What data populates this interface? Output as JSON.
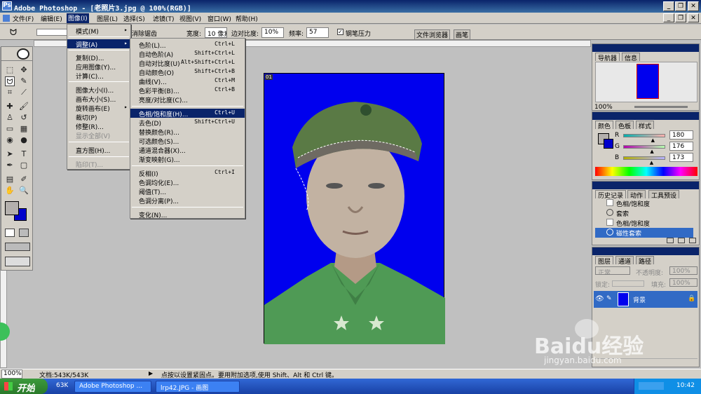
{
  "window": {
    "title": "Adobe Photoshop - [老照片3.jpg @ 100%(RGB)]"
  },
  "menubar": {
    "items": [
      "文件(F)",
      "编辑(E)",
      "图像(I)",
      "图层(L)",
      "选择(S)",
      "滤镜(T)",
      "视图(V)",
      "窗口(W)",
      "帮助(H)"
    ]
  },
  "options": {
    "anti_alias": "消除锯齿",
    "width_label": "宽度:",
    "width_value": "10 像素",
    "edge_contrast_label": "边对比度:",
    "edge_contrast_value": "10%",
    "frequency_label": "频率:",
    "frequency_value": "57",
    "pen_pressure": "钢笔压力",
    "tab_file_browser": "文件浏览器",
    "tab_brushes": "画笔"
  },
  "image_menu": {
    "items": [
      "模式(M)",
      "调整(A)",
      "复制(D)...",
      "应用图像(Y)...",
      "计算(C)...",
      "图像大小(I)...",
      "画布大小(S)...",
      "旋转画布(E)",
      "裁切(P)",
      "修整(R)...",
      "显示全部(V)",
      "直方图(H)...",
      "陷印(T)..."
    ]
  },
  "adjust_menu": {
    "items": [
      {
        "label": "色阶(L)...",
        "shortcut": "Ctrl+L"
      },
      {
        "label": "自动色阶(A)",
        "shortcut": "Shift+Ctrl+L"
      },
      {
        "label": "自动对比度(U)",
        "shortcut": "Alt+Shift+Ctrl+L"
      },
      {
        "label": "自动颜色(O)",
        "shortcut": "Shift+Ctrl+B"
      },
      {
        "label": "曲线(V)...",
        "shortcut": "Ctrl+M"
      },
      {
        "label": "色彩平衡(B)...",
        "shortcut": "Ctrl+B"
      },
      {
        "label": "亮度/对比度(C)...",
        "shortcut": ""
      },
      {
        "label": "色相/饱和度(H)...",
        "shortcut": "Ctrl+U"
      },
      {
        "label": "去色(D)",
        "shortcut": "Shift+Ctrl+U"
      },
      {
        "label": "替换颜色(R)...",
        "shortcut": ""
      },
      {
        "label": "可选颜色(S)...",
        "shortcut": ""
      },
      {
        "label": "通道混合器(X)...",
        "shortcut": ""
      },
      {
        "label": "渐变映射(G)...",
        "shortcut": ""
      },
      {
        "label": "反相(I)",
        "shortcut": "Ctrl+I"
      },
      {
        "label": "色调均化(E)...",
        "shortcut": ""
      },
      {
        "label": "阈值(T)...",
        "shortcut": ""
      },
      {
        "label": "色调分离(P)...",
        "shortcut": ""
      },
      {
        "label": "变化(N)...",
        "shortcut": ""
      }
    ]
  },
  "navigator": {
    "tab1": "导航器",
    "tab2": "信息",
    "zoom": "100%"
  },
  "color": {
    "tab1": "颜色",
    "tab2": "色板",
    "tab3": "样式",
    "r_label": "R",
    "g_label": "G",
    "b_label": "B",
    "r": "180",
    "g": "176",
    "b": "173",
    "r_frac": 0.71,
    "g_frac": 0.69,
    "b_frac": 0.68
  },
  "history": {
    "tab1": "历史记录",
    "tab2": "动作",
    "tab3": "工具预设",
    "items": [
      "色相/饱和度",
      "套索",
      "色相/饱和度",
      "磁性套索"
    ]
  },
  "layers": {
    "tab1": "图层",
    "tab2": "通道",
    "tab3": "路径",
    "blend": "正常",
    "opacity_label": "不透明度:",
    "opacity": "100%",
    "lock_label": "锁定:",
    "fill_label": "填充:",
    "fill": "100%",
    "layer_name": "背景"
  },
  "status": {
    "zoom": "100%",
    "doc": "文档:543K/543K",
    "hint": "点按以设置紧固点。要用附加选项,使用 Shift、Alt 和 Ctrl 键。"
  },
  "taskbar": {
    "start": "开始",
    "zoom_tray": "63K",
    "task1": "Adobe Photoshop ...",
    "task2": "lrp42.JPG - 画图",
    "time": "10:42"
  },
  "doc_tabs": {
    "t1": "01"
  },
  "watermark": {
    "brand": "Baidu经验",
    "url": "jingyan.baidu.com"
  },
  "colors": {
    "doc_bg": "#0000ee",
    "menu_highlight": "#0a246a",
    "taskbar": "#245edb"
  }
}
